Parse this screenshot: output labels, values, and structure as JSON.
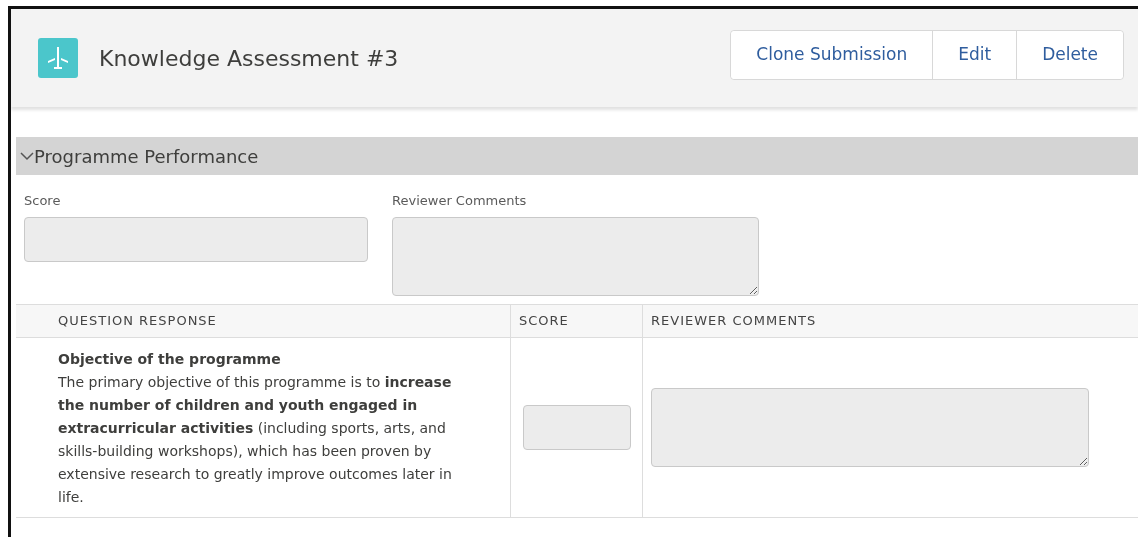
{
  "header": {
    "title": "Knowledge Assessment #3",
    "buttons": [
      "Clone Submission",
      "Edit",
      "Delete"
    ]
  },
  "section": {
    "title": "Programme Performance",
    "expanded": true,
    "fields": [
      {
        "label": "Score",
        "kind": "input"
      },
      {
        "label": "Reviewer Comments",
        "kind": "textarea"
      }
    ],
    "table": {
      "columns": [
        "QUESTION RESPONSE",
        "SCORE",
        "REVIEWER COMMENTS"
      ],
      "rows": [
        {
          "question": "Objective of the programme",
          "response": "The primary objective of this programme is to **increase the number of children and youth engaged in extracurricular activities** (including sports, arts, and skills-building workshops), which has been proven by extensive research to greatly improve outcomes later in life."
        }
      ]
    }
  }
}
